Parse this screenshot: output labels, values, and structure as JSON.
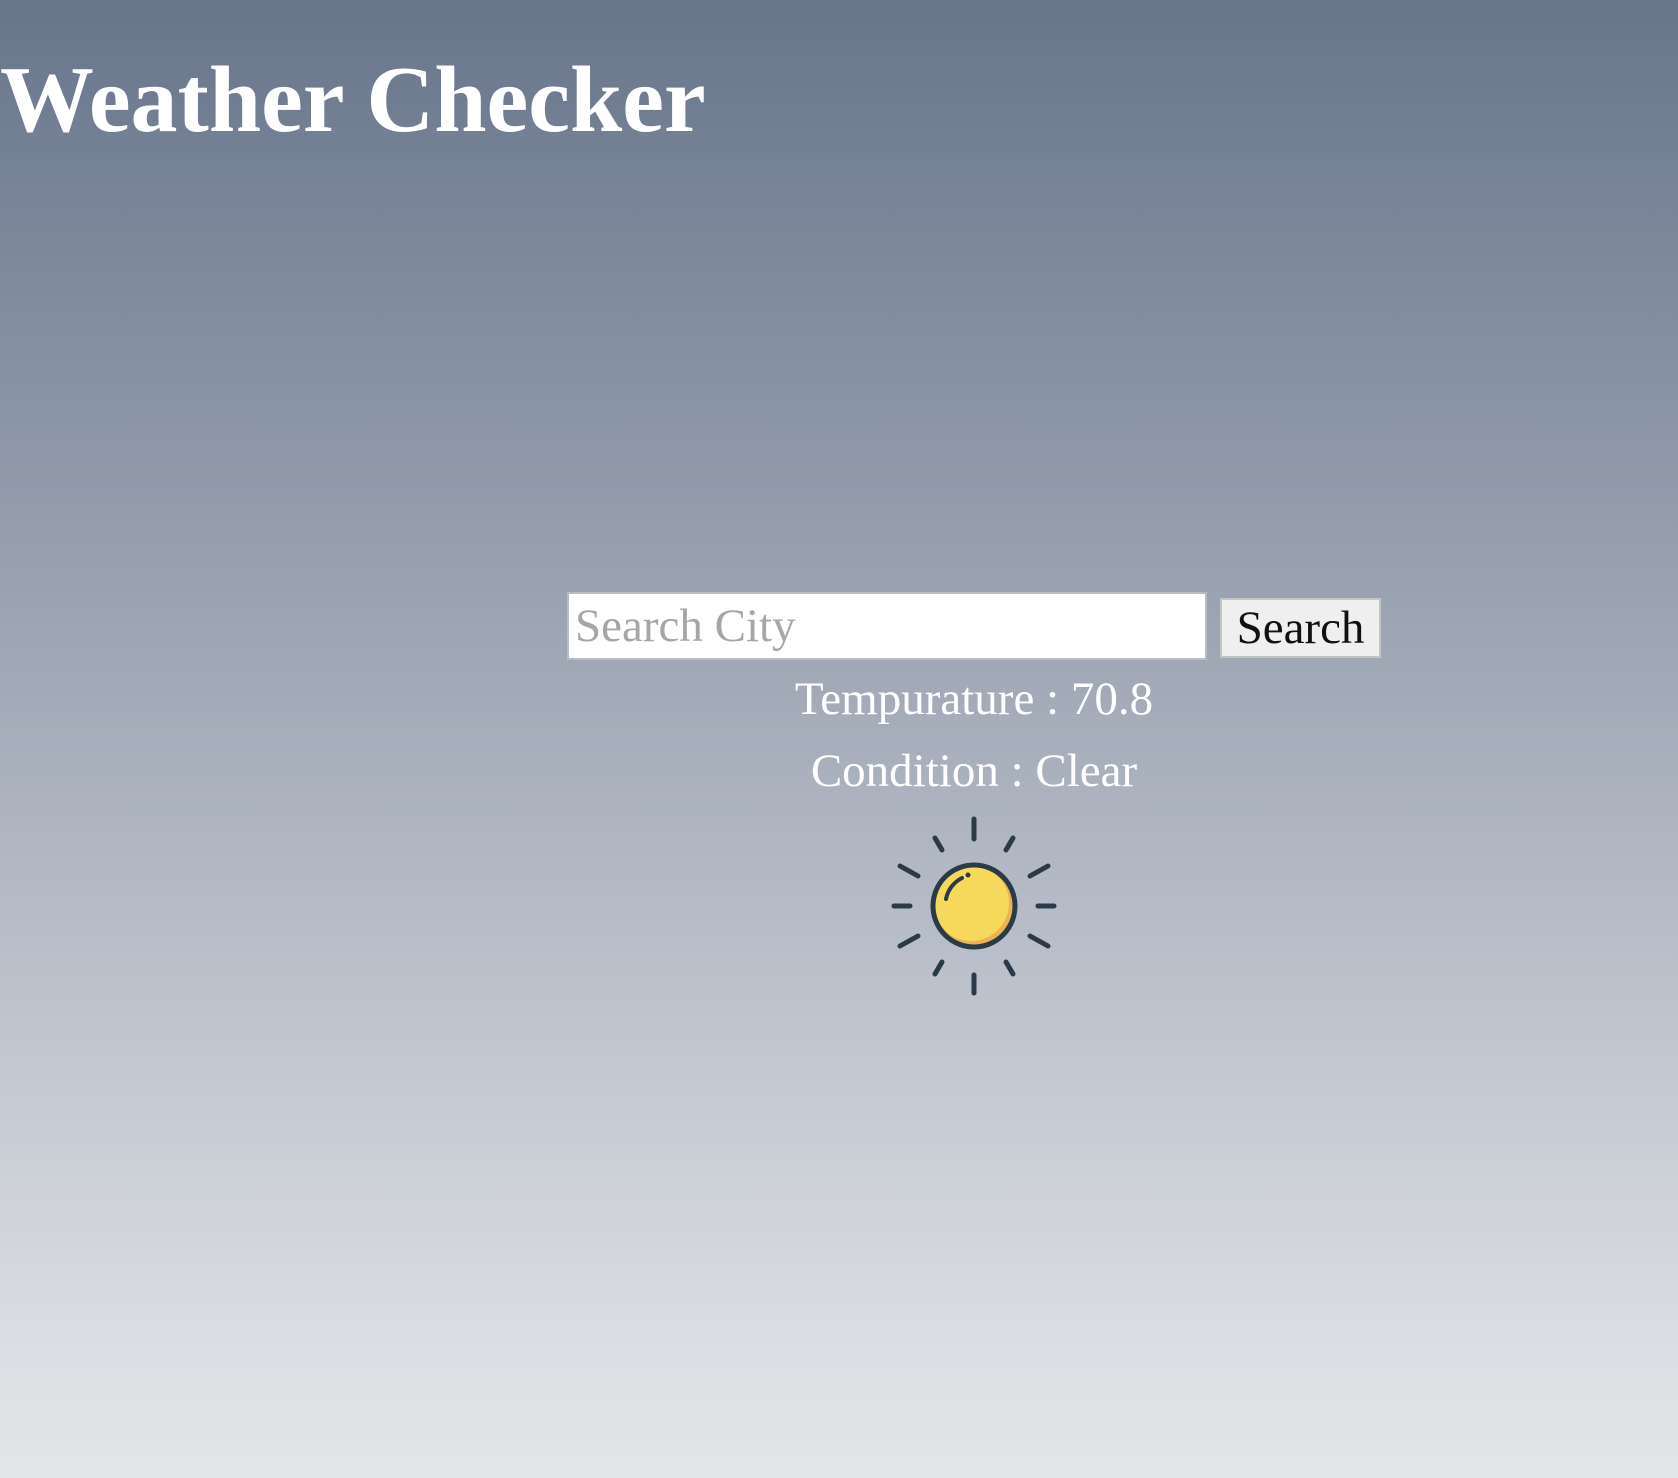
{
  "page": {
    "title": "Weather Checker"
  },
  "search": {
    "placeholder": "Search City",
    "value": "",
    "button_label": "Search"
  },
  "weather": {
    "temperature_label": "Tempurature",
    "temperature_value": "70.8",
    "temperature_text": "Tempurature : 70.8",
    "condition_label": "Condition",
    "condition_value": "Clear",
    "condition_text": "Condition : Clear",
    "icon": "sun-icon"
  },
  "colors": {
    "title_text": "#ffffff",
    "sun_fill": "#f6d95a",
    "sun_shade": "#ecb354",
    "icon_stroke": "#2b3a48"
  }
}
